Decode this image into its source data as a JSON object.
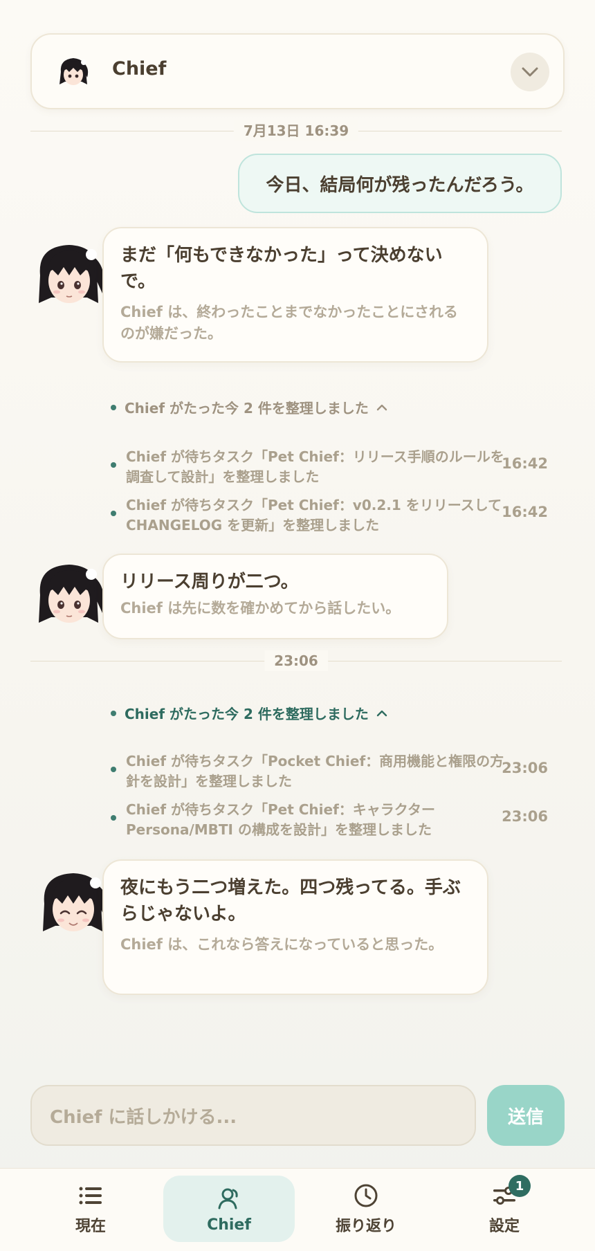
{
  "header": {
    "title": "Chief"
  },
  "dividers": {
    "first": "7月13日 16:39",
    "second": "23:06"
  },
  "messages": {
    "user1": "今日、結局何が残ったんだろう。",
    "chief1": {
      "main": "まだ「何もできなかった」って決めないで。",
      "sub": "Chief は、終わったことまでなかったことにされるのが嫌だった。"
    },
    "chief2": {
      "main": "リリース周りが二つ。",
      "sub": "Chief は先に数を確かめてから話したい。"
    },
    "chief3": {
      "main": "夜にもう二つ増えた。四つ残ってる。手ぶらじゃないよ。",
      "sub": "Chief は、これなら答えになっていると思った。"
    }
  },
  "activity1": {
    "header": "Chief がたった今 2 件を整理しました",
    "items": [
      {
        "text": "Chief が待ちタスク「Pet Chief：リリース手順のルールを調査して設計」を整理しました",
        "time": "16:42"
      },
      {
        "text": "Chief が待ちタスク「Pet Chief：v0.2.1 をリリースして CHANGELOG を更新」を整理しました",
        "time": "16:42"
      }
    ]
  },
  "activity2": {
    "header": "Chief がたった今 2 件を整理しました",
    "items": [
      {
        "text": "Chief が待ちタスク「Pocket Chief：商用機能と権限の方針を設計」を整理しました",
        "time": "23:06"
      },
      {
        "text": "Chief が待ちタスク「Pet Chief：キャラクター Persona/MBTI の構成を設計」を整理しました",
        "time": "23:06"
      }
    ]
  },
  "composer": {
    "placeholder": "Chief に話しかける...",
    "send_label": "送信"
  },
  "nav": {
    "items": [
      {
        "label": "現在",
        "icon": "list-icon"
      },
      {
        "label": "Chief",
        "icon": "person-icon"
      },
      {
        "label": "振り返り",
        "icon": "clock-icon"
      },
      {
        "label": "設定",
        "icon": "sliders-icon",
        "badge": "1"
      }
    ],
    "active": "Chief"
  },
  "colors": {
    "accent": "#2f6d61",
    "send_button": "#99d5c8",
    "user_bubble_bg": "#eef8f4",
    "activity_header_2": "#2e6b5f"
  }
}
